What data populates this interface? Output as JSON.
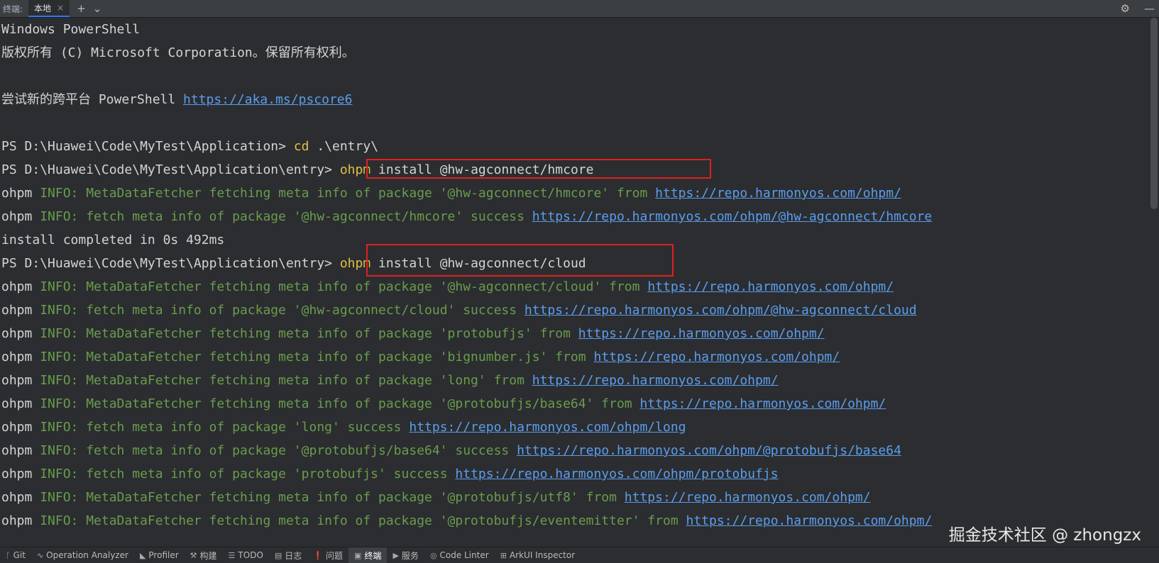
{
  "topbar": {
    "label": "终端:",
    "tab_label": "本地",
    "tab_close": "×",
    "add": "+",
    "dropdown": "⌄",
    "gear": "⚙",
    "minimize": "—"
  },
  "terminal_lines": [
    [
      [
        "w",
        "Windows PowerShell"
      ]
    ],
    [
      [
        "w",
        "版权所有 (C) Microsoft Corporation。保留所有权利。"
      ]
    ],
    [
      [
        "w",
        ""
      ]
    ],
    [
      [
        "w",
        "尝试新的跨平台 PowerShell "
      ],
      [
        "u",
        "https://aka.ms/pscore6"
      ]
    ],
    [
      [
        "w",
        ""
      ]
    ],
    [
      [
        "w",
        "PS D:\\Huawei\\Code\\MyTest\\Application> "
      ],
      [
        "y",
        "cd"
      ],
      [
        "w",
        " .\\entry\\"
      ]
    ],
    [
      [
        "w",
        "PS D:\\Huawei\\Code\\MyTest\\Application\\entry> "
      ],
      [
        "y",
        "ohpm"
      ],
      [
        "w",
        " install @hw-agconnect/hmcore"
      ]
    ],
    [
      [
        "w",
        "ohpm "
      ],
      [
        "g",
        "INFO: MetaDataFetcher fetching meta info of package '@hw-agconnect/hmcore' from "
      ],
      [
        "u",
        "https://repo.harmonyos.com/ohpm/"
      ]
    ],
    [
      [
        "w",
        "ohpm "
      ],
      [
        "g",
        "INFO: fetch meta info of package '@hw-agconnect/hmcore' success "
      ],
      [
        "u",
        "https://repo.harmonyos.com/ohpm/@hw-agconnect/hmcore"
      ]
    ],
    [
      [
        "w",
        "install completed in 0s 492ms"
      ]
    ],
    [
      [
        "w",
        "PS D:\\Huawei\\Code\\MyTest\\Application\\entry> "
      ],
      [
        "y",
        "ohpm"
      ],
      [
        "w",
        " install @hw-agconnect/cloud"
      ]
    ],
    [
      [
        "w",
        "ohpm "
      ],
      [
        "g",
        "INFO: MetaDataFetcher fetching meta info of package '@hw-agconnect/cloud' from "
      ],
      [
        "u",
        "https://repo.harmonyos.com/ohpm/"
      ]
    ],
    [
      [
        "w",
        "ohpm "
      ],
      [
        "g",
        "INFO: fetch meta info of package '@hw-agconnect/cloud' success "
      ],
      [
        "u",
        "https://repo.harmonyos.com/ohpm/@hw-agconnect/cloud"
      ]
    ],
    [
      [
        "w",
        "ohpm "
      ],
      [
        "g",
        "INFO: MetaDataFetcher fetching meta info of package 'protobufjs' from "
      ],
      [
        "u",
        "https://repo.harmonyos.com/ohpm/"
      ]
    ],
    [
      [
        "w",
        "ohpm "
      ],
      [
        "g",
        "INFO: MetaDataFetcher fetching meta info of package 'bignumber.js' from "
      ],
      [
        "u",
        "https://repo.harmonyos.com/ohpm/"
      ]
    ],
    [
      [
        "w",
        "ohpm "
      ],
      [
        "g",
        "INFO: MetaDataFetcher fetching meta info of package 'long' from "
      ],
      [
        "u",
        "https://repo.harmonyos.com/ohpm/"
      ]
    ],
    [
      [
        "w",
        "ohpm "
      ],
      [
        "g",
        "INFO: MetaDataFetcher fetching meta info of package '@protobufjs/base64' from "
      ],
      [
        "u",
        "https://repo.harmonyos.com/ohpm/"
      ]
    ],
    [
      [
        "w",
        "ohpm "
      ],
      [
        "g",
        "INFO: fetch meta info of package 'long' success "
      ],
      [
        "u",
        "https://repo.harmonyos.com/ohpm/long"
      ]
    ],
    [
      [
        "w",
        "ohpm "
      ],
      [
        "g",
        "INFO: fetch meta info of package '@protobufjs/base64' success "
      ],
      [
        "u",
        "https://repo.harmonyos.com/ohpm/@protobufjs/base64"
      ]
    ],
    [
      [
        "w",
        "ohpm "
      ],
      [
        "g",
        "INFO: fetch meta info of package 'protobufjs' success "
      ],
      [
        "u",
        "https://repo.harmonyos.com/ohpm/protobufjs"
      ]
    ],
    [
      [
        "w",
        "ohpm "
      ],
      [
        "g",
        "INFO: MetaDataFetcher fetching meta info of package '@protobufjs/utf8' from "
      ],
      [
        "u",
        "https://repo.harmonyos.com/ohpm/"
      ]
    ],
    [
      [
        "w",
        "ohpm "
      ],
      [
        "g",
        "INFO: MetaDataFetcher fetching meta info of package '@protobufjs/eventemitter' from "
      ],
      [
        "u",
        "https://repo.harmonyos.com/ohpm/"
      ]
    ]
  ],
  "watermark": "掘金技术社区 @ zhongzx",
  "bottombar": {
    "items": [
      {
        "icon": "ᚴ",
        "label": "Git"
      },
      {
        "icon": "∿",
        "label": "Operation Analyzer"
      },
      {
        "icon": "◣",
        "label": "Profiler"
      },
      {
        "icon": "⚒",
        "label": "构建"
      },
      {
        "icon": "☰",
        "label": "TODO"
      },
      {
        "icon": "▤",
        "label": "日志"
      },
      {
        "icon": "❗",
        "label": "问题"
      },
      {
        "icon": "▣",
        "label": "终端"
      },
      {
        "icon": "▶",
        "label": "服务"
      },
      {
        "icon": "◎",
        "label": "Code Linter"
      },
      {
        "icon": "⊞",
        "label": "ArkUI Inspector"
      }
    ]
  }
}
